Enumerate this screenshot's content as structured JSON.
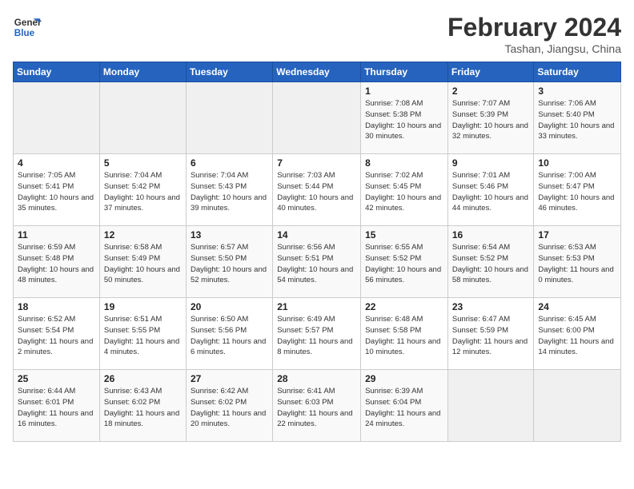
{
  "header": {
    "logo_line1": "General",
    "logo_line2": "Blue",
    "month": "February 2024",
    "location": "Tashan, Jiangsu, China"
  },
  "days_of_week": [
    "Sunday",
    "Monday",
    "Tuesday",
    "Wednesday",
    "Thursday",
    "Friday",
    "Saturday"
  ],
  "weeks": [
    [
      {
        "day": "",
        "sunrise": "",
        "sunset": "",
        "daylight": "",
        "empty": true
      },
      {
        "day": "",
        "sunrise": "",
        "sunset": "",
        "daylight": "",
        "empty": true
      },
      {
        "day": "",
        "sunrise": "",
        "sunset": "",
        "daylight": "",
        "empty": true
      },
      {
        "day": "",
        "sunrise": "",
        "sunset": "",
        "daylight": "",
        "empty": true
      },
      {
        "day": "1",
        "sunrise": "Sunrise: 7:08 AM",
        "sunset": "Sunset: 5:38 PM",
        "daylight": "Daylight: 10 hours and 30 minutes.",
        "empty": false
      },
      {
        "day": "2",
        "sunrise": "Sunrise: 7:07 AM",
        "sunset": "Sunset: 5:39 PM",
        "daylight": "Daylight: 10 hours and 32 minutes.",
        "empty": false
      },
      {
        "day": "3",
        "sunrise": "Sunrise: 7:06 AM",
        "sunset": "Sunset: 5:40 PM",
        "daylight": "Daylight: 10 hours and 33 minutes.",
        "empty": false
      }
    ],
    [
      {
        "day": "4",
        "sunrise": "Sunrise: 7:05 AM",
        "sunset": "Sunset: 5:41 PM",
        "daylight": "Daylight: 10 hours and 35 minutes.",
        "empty": false
      },
      {
        "day": "5",
        "sunrise": "Sunrise: 7:04 AM",
        "sunset": "Sunset: 5:42 PM",
        "daylight": "Daylight: 10 hours and 37 minutes.",
        "empty": false
      },
      {
        "day": "6",
        "sunrise": "Sunrise: 7:04 AM",
        "sunset": "Sunset: 5:43 PM",
        "daylight": "Daylight: 10 hours and 39 minutes.",
        "empty": false
      },
      {
        "day": "7",
        "sunrise": "Sunrise: 7:03 AM",
        "sunset": "Sunset: 5:44 PM",
        "daylight": "Daylight: 10 hours and 40 minutes.",
        "empty": false
      },
      {
        "day": "8",
        "sunrise": "Sunrise: 7:02 AM",
        "sunset": "Sunset: 5:45 PM",
        "daylight": "Daylight: 10 hours and 42 minutes.",
        "empty": false
      },
      {
        "day": "9",
        "sunrise": "Sunrise: 7:01 AM",
        "sunset": "Sunset: 5:46 PM",
        "daylight": "Daylight: 10 hours and 44 minutes.",
        "empty": false
      },
      {
        "day": "10",
        "sunrise": "Sunrise: 7:00 AM",
        "sunset": "Sunset: 5:47 PM",
        "daylight": "Daylight: 10 hours and 46 minutes.",
        "empty": false
      }
    ],
    [
      {
        "day": "11",
        "sunrise": "Sunrise: 6:59 AM",
        "sunset": "Sunset: 5:48 PM",
        "daylight": "Daylight: 10 hours and 48 minutes.",
        "empty": false
      },
      {
        "day": "12",
        "sunrise": "Sunrise: 6:58 AM",
        "sunset": "Sunset: 5:49 PM",
        "daylight": "Daylight: 10 hours and 50 minutes.",
        "empty": false
      },
      {
        "day": "13",
        "sunrise": "Sunrise: 6:57 AM",
        "sunset": "Sunset: 5:50 PM",
        "daylight": "Daylight: 10 hours and 52 minutes.",
        "empty": false
      },
      {
        "day": "14",
        "sunrise": "Sunrise: 6:56 AM",
        "sunset": "Sunset: 5:51 PM",
        "daylight": "Daylight: 10 hours and 54 minutes.",
        "empty": false
      },
      {
        "day": "15",
        "sunrise": "Sunrise: 6:55 AM",
        "sunset": "Sunset: 5:52 PM",
        "daylight": "Daylight: 10 hours and 56 minutes.",
        "empty": false
      },
      {
        "day": "16",
        "sunrise": "Sunrise: 6:54 AM",
        "sunset": "Sunset: 5:52 PM",
        "daylight": "Daylight: 10 hours and 58 minutes.",
        "empty": false
      },
      {
        "day": "17",
        "sunrise": "Sunrise: 6:53 AM",
        "sunset": "Sunset: 5:53 PM",
        "daylight": "Daylight: 11 hours and 0 minutes.",
        "empty": false
      }
    ],
    [
      {
        "day": "18",
        "sunrise": "Sunrise: 6:52 AM",
        "sunset": "Sunset: 5:54 PM",
        "daylight": "Daylight: 11 hours and 2 minutes.",
        "empty": false
      },
      {
        "day": "19",
        "sunrise": "Sunrise: 6:51 AM",
        "sunset": "Sunset: 5:55 PM",
        "daylight": "Daylight: 11 hours and 4 minutes.",
        "empty": false
      },
      {
        "day": "20",
        "sunrise": "Sunrise: 6:50 AM",
        "sunset": "Sunset: 5:56 PM",
        "daylight": "Daylight: 11 hours and 6 minutes.",
        "empty": false
      },
      {
        "day": "21",
        "sunrise": "Sunrise: 6:49 AM",
        "sunset": "Sunset: 5:57 PM",
        "daylight": "Daylight: 11 hours and 8 minutes.",
        "empty": false
      },
      {
        "day": "22",
        "sunrise": "Sunrise: 6:48 AM",
        "sunset": "Sunset: 5:58 PM",
        "daylight": "Daylight: 11 hours and 10 minutes.",
        "empty": false
      },
      {
        "day": "23",
        "sunrise": "Sunrise: 6:47 AM",
        "sunset": "Sunset: 5:59 PM",
        "daylight": "Daylight: 11 hours and 12 minutes.",
        "empty": false
      },
      {
        "day": "24",
        "sunrise": "Sunrise: 6:45 AM",
        "sunset": "Sunset: 6:00 PM",
        "daylight": "Daylight: 11 hours and 14 minutes.",
        "empty": false
      }
    ],
    [
      {
        "day": "25",
        "sunrise": "Sunrise: 6:44 AM",
        "sunset": "Sunset: 6:01 PM",
        "daylight": "Daylight: 11 hours and 16 minutes.",
        "empty": false
      },
      {
        "day": "26",
        "sunrise": "Sunrise: 6:43 AM",
        "sunset": "Sunset: 6:02 PM",
        "daylight": "Daylight: 11 hours and 18 minutes.",
        "empty": false
      },
      {
        "day": "27",
        "sunrise": "Sunrise: 6:42 AM",
        "sunset": "Sunset: 6:02 PM",
        "daylight": "Daylight: 11 hours and 20 minutes.",
        "empty": false
      },
      {
        "day": "28",
        "sunrise": "Sunrise: 6:41 AM",
        "sunset": "Sunset: 6:03 PM",
        "daylight": "Daylight: 11 hours and 22 minutes.",
        "empty": false
      },
      {
        "day": "29",
        "sunrise": "Sunrise: 6:39 AM",
        "sunset": "Sunset: 6:04 PM",
        "daylight": "Daylight: 11 hours and 24 minutes.",
        "empty": false
      },
      {
        "day": "",
        "sunrise": "",
        "sunset": "",
        "daylight": "",
        "empty": true
      },
      {
        "day": "",
        "sunrise": "",
        "sunset": "",
        "daylight": "",
        "empty": true
      }
    ]
  ]
}
